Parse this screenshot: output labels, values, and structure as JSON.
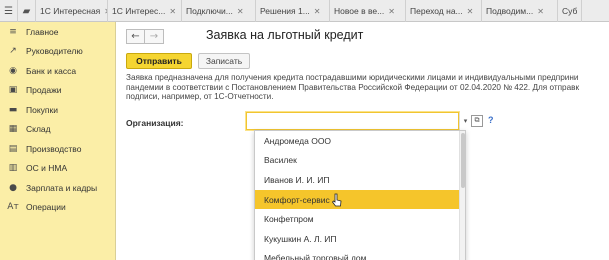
{
  "tabs": {
    "items": [
      {
        "label": "1С Интересная",
        "w": 72
      },
      {
        "label": "1С Интерес...",
        "w": 74
      },
      {
        "label": "Подключи...",
        "w": 74
      },
      {
        "label": "Решения 1...",
        "w": 74
      },
      {
        "label": "Новое в ве...",
        "w": 76
      },
      {
        "label": "Переход на...",
        "w": 76
      },
      {
        "label": "Подводим...",
        "w": 76
      },
      {
        "label": "Суб",
        "w": 24
      }
    ],
    "close_glyph": "✕"
  },
  "sidebar": {
    "items": [
      {
        "label": "Главное",
        "icon": "menu-icon",
        "glyph": "≡"
      },
      {
        "label": "Руководителю",
        "icon": "trend-icon",
        "glyph": "↗"
      },
      {
        "label": "Банк и касса",
        "icon": "bank-icon",
        "glyph": "◉"
      },
      {
        "label": "Продажи",
        "icon": "sales-icon",
        "glyph": "▣"
      },
      {
        "label": "Покупки",
        "icon": "cart-icon",
        "glyph": "▬"
      },
      {
        "label": "Склад",
        "icon": "warehouse-icon",
        "glyph": "▦"
      },
      {
        "label": "Производство",
        "icon": "production-icon",
        "glyph": "▤"
      },
      {
        "label": "ОС и НМА",
        "icon": "assets-icon",
        "glyph": "▥"
      },
      {
        "label": "Зарплата и кадры",
        "icon": "people-icon",
        "glyph": "●"
      },
      {
        "label": "Операции",
        "icon": "operations-icon",
        "glyph": "Ат"
      }
    ]
  },
  "main": {
    "title": "Заявка на льготный кредит",
    "back_glyph": "←",
    "forward_glyph": "→",
    "send_label": "Отправить",
    "save_label": "Записать",
    "description": [
      "Заявка предназначена для получения кредита пострадавшими юридическими лицами и индивидуальными предприни",
      "пандемии в соответствии с Постановлением Правительства Российской Федерации от 02.04.2020 № 422. Для отправк",
      "подписи, например, от 1С-Отчетности."
    ],
    "org_label": "Организация:",
    "org_value": "",
    "help_glyph": "?",
    "dropdown_glyph": "▾",
    "open_glyph": "⧉"
  },
  "dropdown": {
    "options": [
      "Андромеда ООО",
      "Василек",
      "Иванов И. И. ИП",
      "Комфорт-сервис",
      "Конфетпром",
      "Кукушкин А. Л. ИП",
      "Мебельный торговый дом"
    ],
    "selected_index": 3
  },
  "colors": {
    "accent": "#f5d531",
    "sidebar_bg": "#fbeea7",
    "selected_row": "#f5c52b",
    "help": "#3a6fc9"
  }
}
